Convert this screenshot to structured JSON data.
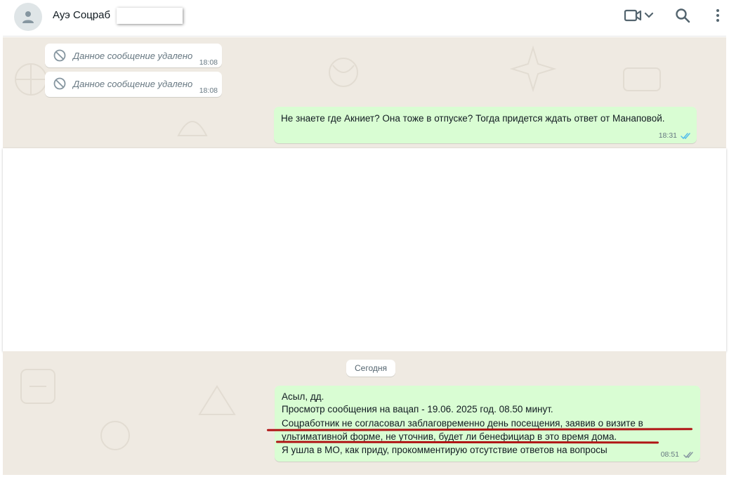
{
  "header": {
    "contact_name": "Ауэ Соцраб",
    "icons": [
      "avatar-icon",
      "video-call-icon",
      "chevron-down-icon",
      "search-icon",
      "menu-icon"
    ]
  },
  "messages": [
    {
      "type": "incoming",
      "deleted": true,
      "text": "Данное сообщение удалено",
      "time": "18:08",
      "icon": "ban-icon"
    },
    {
      "type": "incoming",
      "deleted": true,
      "text": "Данное сообщение удалено",
      "time": "18:08",
      "icon": "ban-icon"
    },
    {
      "type": "outgoing",
      "text": "Не знаете где Акниет? Она тоже в отпуске? Тогда придется ждать ответ от Манаповой.",
      "time": "18:31",
      "status": "read"
    }
  ],
  "date_separator": "Сегодня",
  "last_message": {
    "type": "outgoing",
    "lines": [
      "Асыл, дд.",
      "Просмотр сообщения на вацап - 19.06. 2025 год. 08.50 минут.",
      "Соцработник не согласовал заблаговременно день посещения, заявив о визите в",
      "ультимативной форме, не уточнив, будет ли бенефициар в это время дома.",
      "Я ушла в МО, как приду, прокомментирую отсутствие ответов на вопросы"
    ],
    "time": "08:51",
    "status": "delivered"
  },
  "colors": {
    "outgoing_bubble": "#d9fdd3",
    "incoming_bubble": "#ffffff",
    "chat_background": "#efeae2",
    "read_ticks": "#53bdeb",
    "delivered_ticks": "#8696a0",
    "annotation_underline": "#b01515"
  }
}
